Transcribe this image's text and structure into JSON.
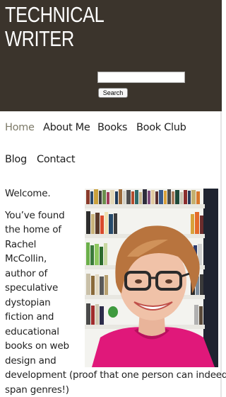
{
  "header": {
    "title_line1": "TECHNICAL",
    "title_line2": "WRITER",
    "search_placeholder": "",
    "search_button": "Search"
  },
  "nav": {
    "items": [
      {
        "label": "Home",
        "active": true
      },
      {
        "label": "About Me"
      },
      {
        "label": "Books"
      },
      {
        "label": "Book Club"
      },
      {
        "label": "Blog"
      },
      {
        "label": "Contact"
      }
    ]
  },
  "content": {
    "welcome": "Welcome.",
    "intro_lines": [
      "You’ve found",
      "the home of",
      "Rachel",
      "McCollin,",
      "author of",
      "speculative",
      "dystopian",
      "fiction and",
      "educational",
      "books on web",
      "design and",
      "development (proof that one person can indeed",
      "span genres!)"
    ]
  },
  "colors": {
    "header_bg": "#3b342c",
    "nav_active": "#7d7a68"
  }
}
